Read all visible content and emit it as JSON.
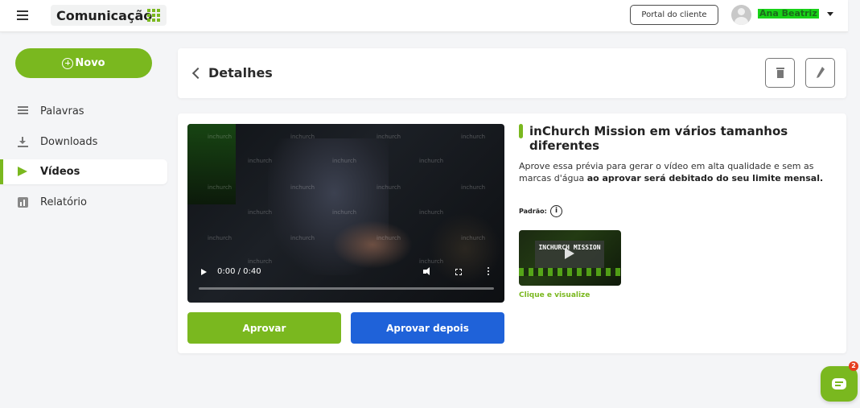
{
  "header": {
    "app_title": "Comunicação",
    "portal_button": "Portal do cliente",
    "user_name": "Ana Beatriz"
  },
  "sidebar": {
    "new_button": "Novo",
    "items": [
      {
        "label": "Palavras",
        "icon": "lines-icon",
        "active": false
      },
      {
        "label": "Downloads",
        "icon": "download-icon",
        "active": false
      },
      {
        "label": "Vídeos",
        "icon": "play-icon",
        "active": true
      },
      {
        "label": "Relatório",
        "icon": "report-icon",
        "active": false
      }
    ]
  },
  "details": {
    "title": "Detalhes",
    "delete_icon": "trash-icon",
    "edit_icon": "pencil-icon"
  },
  "video": {
    "current_time": "0:00 / 0:40",
    "watermark": "inchurch",
    "title": "inChurch Mission em vários tamanhos diferentes",
    "description_plain": "Aprove essa prévia para gerar o vídeo em alta qualidade e sem as marcas d'água ",
    "description_bold": "ao aprovar será debitado do seu limite mensal.",
    "default_label": "Padrão:",
    "info_icon": "i",
    "thumbnail_text": "INCHURCH MISSION",
    "thumbnail_link": "Clique e visualize",
    "approve_button": "Aprovar",
    "approve_later_button": "Aprovar depois"
  },
  "chat": {
    "badge_count": "2"
  },
  "colors": {
    "accent_green": "#7ab81f",
    "primary_blue": "#1f62d9",
    "badge_red": "#e53e1f"
  }
}
